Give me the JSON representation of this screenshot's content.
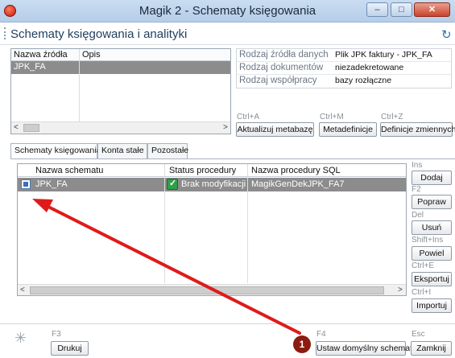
{
  "window": {
    "title": "Magik 2 - Schematy księgowania",
    "min_glyph": "‒",
    "max_glyph": "□",
    "close_glyph": "✕"
  },
  "header": {
    "title": "Schematy księgowania i analityki",
    "refresh_glyph": "↻"
  },
  "source_grid": {
    "columns": [
      "Nazwa źródła",
      "Opis"
    ],
    "rows": [
      {
        "name": "JPK_FA",
        "description": ""
      }
    ]
  },
  "properties": [
    {
      "label": "Rodzaj źródła danych",
      "value": "Plik JPK faktury - JPK_FA"
    },
    {
      "label": "Rodzaj dokumentów",
      "value": "niezadekretowane"
    },
    {
      "label": "Rodzaj współpracy",
      "value": "bazy rozłączne"
    }
  ],
  "top_actions": [
    {
      "shortcut": "Ctrl+A",
      "label": "Aktualizuj metabazę"
    },
    {
      "shortcut": "Ctrl+M",
      "label": "Metadefinicje"
    },
    {
      "shortcut": "Ctrl+Z",
      "label": "Definicje zmiennych"
    }
  ],
  "tabs": [
    "Schematy księgowania",
    "Konta stałe",
    "Pozostałe"
  ],
  "schema_grid": {
    "columns": [
      "Nazwa schematu",
      "Status procedury",
      "Nazwa procedury SQL"
    ],
    "rows": [
      {
        "name": "JPK_FA",
        "status": "Brak modyfikacji",
        "procedure": "MagikGenDekJPK_FA7",
        "checked": true
      }
    ]
  },
  "right_actions": [
    {
      "shortcut": "Ins",
      "label": "Dodaj"
    },
    {
      "shortcut": "F2",
      "label": "Popraw"
    },
    {
      "shortcut": "Del",
      "label": "Usuń"
    },
    {
      "shortcut": "Shift+Ins",
      "label": "Powiel"
    },
    {
      "shortcut": "Ctrl+E",
      "label": "Eksportuj"
    },
    {
      "shortcut": "Ctrl+I",
      "label": "Importuj"
    }
  ],
  "footer": {
    "print": {
      "shortcut": "F3",
      "label": "Drukuj"
    },
    "set_default": {
      "shortcut": "F4",
      "label": "Ustaw domyślny schemat"
    },
    "close": {
      "shortcut": "Esc",
      "label": "Zamknij"
    }
  },
  "annotation": {
    "badge": "1",
    "arrow_color": "#e01a1a",
    "badge_color": "#8c1b10"
  },
  "scroll": {
    "left_glyph": "<",
    "right_glyph": ">"
  }
}
